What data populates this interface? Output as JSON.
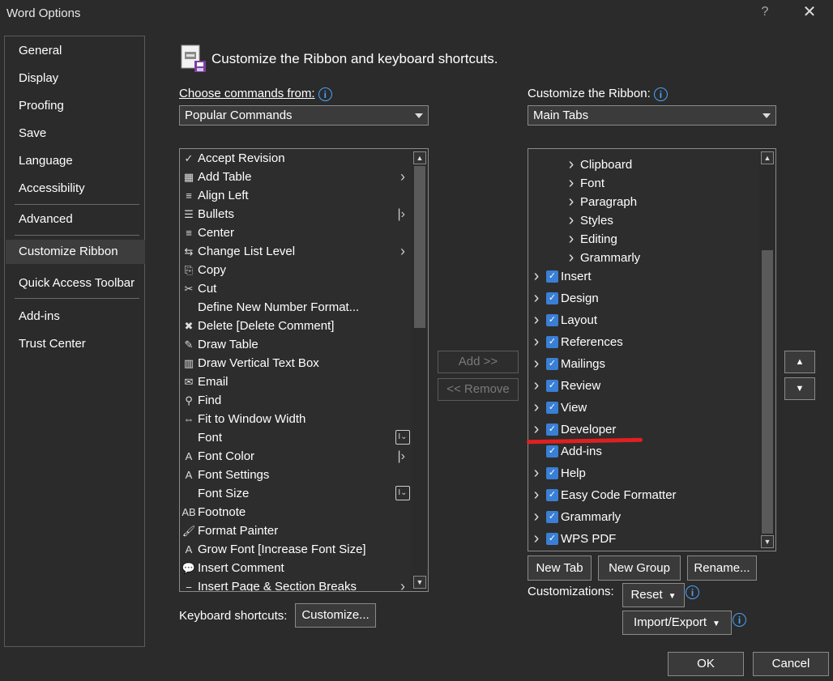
{
  "window": {
    "title": "Word Options",
    "help_glyph": "?",
    "close_glyph": "✕"
  },
  "nav": {
    "items": [
      {
        "label": "General"
      },
      {
        "label": "Display"
      },
      {
        "label": "Proofing"
      },
      {
        "label": "Save"
      },
      {
        "label": "Language"
      },
      {
        "label": "Accessibility"
      },
      {
        "label": "Advanced"
      },
      {
        "label": "Customize Ribbon"
      },
      {
        "label": "Quick Access Toolbar"
      },
      {
        "label": "Add-ins"
      },
      {
        "label": "Trust Center"
      }
    ],
    "selected": "Customize Ribbon"
  },
  "header": {
    "title": "Customize the Ribbon and keyboard shortcuts."
  },
  "choose_commands": {
    "label": "Choose commands from:",
    "value": "Popular Commands"
  },
  "customize_ribbon": {
    "label": "Customize the Ribbon:",
    "value": "Main Tabs"
  },
  "commands": [
    {
      "label": "Accept Revision",
      "icon": "✓"
    },
    {
      "label": "Add Table",
      "icon": "▦",
      "submenu": "arrow"
    },
    {
      "label": "Align Left",
      "icon": "≡"
    },
    {
      "label": "Bullets",
      "icon": "☰",
      "submenu": "split"
    },
    {
      "label": "Center",
      "icon": "≡"
    },
    {
      "label": "Change List Level",
      "icon": "⇆",
      "submenu": "arrow"
    },
    {
      "label": "Copy",
      "icon": "⎘"
    },
    {
      "label": "Cut",
      "icon": "✂"
    },
    {
      "label": "Define New Number Format...",
      "icon": ""
    },
    {
      "label": "Delete [Delete Comment]",
      "icon": "✖"
    },
    {
      "label": "Draw Table",
      "icon": "✎"
    },
    {
      "label": "Draw Vertical Text Box",
      "icon": "▥"
    },
    {
      "label": "Email",
      "icon": "✉"
    },
    {
      "label": "Find",
      "icon": "⚲"
    },
    {
      "label": "Fit to Window Width",
      "icon": "⇔"
    },
    {
      "label": "Font",
      "icon": "",
      "submenu": "box"
    },
    {
      "label": "Font Color",
      "icon": "A",
      "submenu": "split"
    },
    {
      "label": "Font Settings",
      "icon": "A"
    },
    {
      "label": "Font Size",
      "icon": "",
      "submenu": "box"
    },
    {
      "label": "Footnote",
      "icon": "AB"
    },
    {
      "label": "Format Painter",
      "icon": "🖌"
    },
    {
      "label": "Grow Font [Increase Font Size]",
      "icon": "A"
    },
    {
      "label": "Insert Comment",
      "icon": "💬"
    },
    {
      "label": "Insert Page & Section Breaks",
      "icon": "⎯",
      "submenu": "arrow"
    }
  ],
  "ribbon_tree": [
    {
      "label": "Clipboard",
      "level": 2
    },
    {
      "label": "Font",
      "level": 2
    },
    {
      "label": "Paragraph",
      "level": 2
    },
    {
      "label": "Styles",
      "level": 2
    },
    {
      "label": "Editing",
      "level": 2
    },
    {
      "label": "Grammarly",
      "level": 2
    },
    {
      "label": "Insert",
      "level": 1,
      "expand": true
    },
    {
      "label": "Design",
      "level": 1,
      "expand": true
    },
    {
      "label": "Layout",
      "level": 1,
      "expand": true
    },
    {
      "label": "References",
      "level": 1,
      "expand": true
    },
    {
      "label": "Mailings",
      "level": 1,
      "expand": true
    },
    {
      "label": "Review",
      "level": 1,
      "expand": true
    },
    {
      "label": "View",
      "level": 1,
      "expand": true
    },
    {
      "label": "Developer",
      "level": 1,
      "expand": true
    },
    {
      "label": "Add-ins",
      "level": 1,
      "expand": false
    },
    {
      "label": "Help",
      "level": 1,
      "expand": true
    },
    {
      "label": "Easy Code Formatter",
      "level": 1,
      "expand": true
    },
    {
      "label": "Grammarly",
      "level": 1,
      "expand": true
    },
    {
      "label": "WPS PDF",
      "level": 1,
      "expand": true
    }
  ],
  "buttons": {
    "add": "Add >>",
    "remove": "<< Remove",
    "new_tab": "New Tab",
    "new_group": "New Group",
    "rename": "Rename...",
    "reset": "Reset",
    "import_export": "Import/Export",
    "customize": "Customize...",
    "ok": "OK",
    "cancel": "Cancel",
    "move_up": "▲",
    "move_down": "▼"
  },
  "labels": {
    "keyboard_shortcuts": "Keyboard shortcuts:",
    "customizations": "Customizations:"
  },
  "colors": {
    "background": "#2b2b2b",
    "accent": "#3a7fd6",
    "info": "#4aa3ff",
    "annotation": "#e02020"
  }
}
